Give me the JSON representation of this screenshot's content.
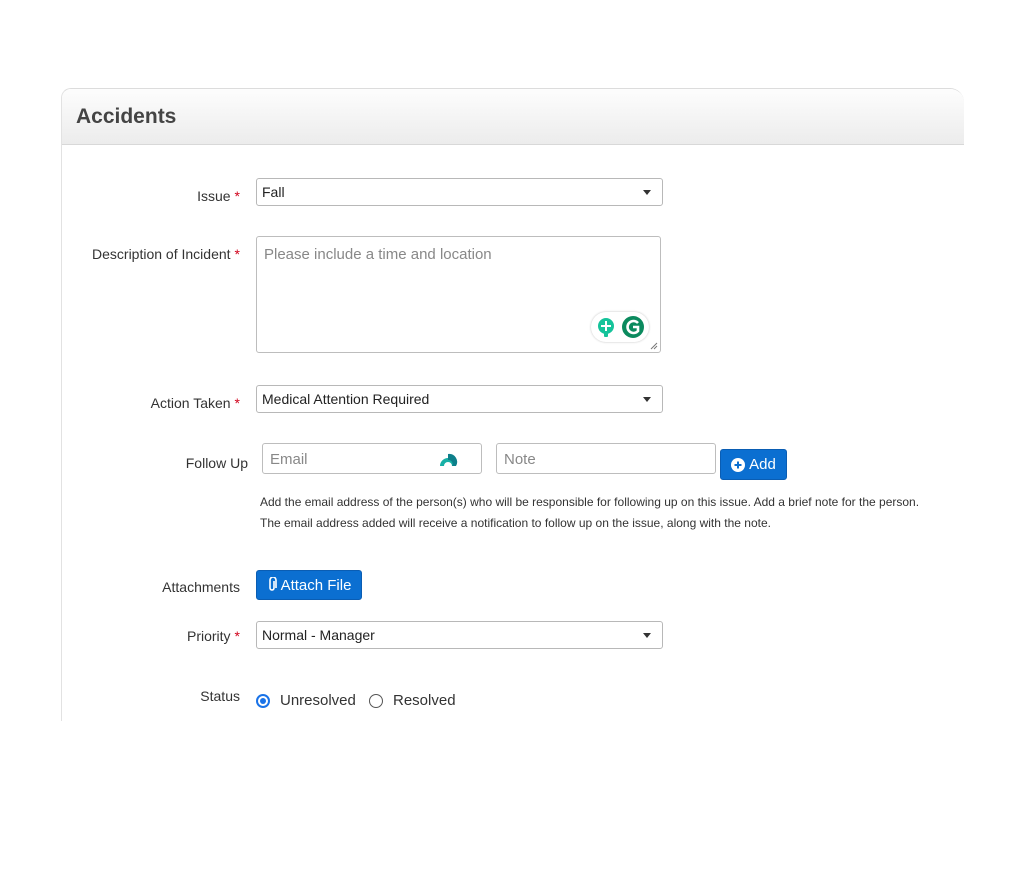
{
  "panel": {
    "title": "Accidents"
  },
  "issue": {
    "label": "Issue",
    "required": "*",
    "value": "Fall"
  },
  "description": {
    "label": "Description of Incident",
    "required": "*",
    "placeholder": "Please include a time and location"
  },
  "action": {
    "label": "Action Taken",
    "required": "*",
    "value": "Medical Attention Required"
  },
  "follow_up": {
    "label": "Follow Up",
    "email_placeholder": "Email",
    "note_placeholder": "Note",
    "add_label": "Add",
    "help_line1": "Add the email address of the person(s) who will be responsible for following up on this issue. Add a brief note for the person.",
    "help_line2": "The email address added will receive a notification to follow up on the issue, along with the note."
  },
  "attachments": {
    "label": "Attachments",
    "button_label": "Attach File"
  },
  "priority": {
    "label": "Priority",
    "required": "*",
    "value": "Normal - Manager"
  },
  "status": {
    "label": "Status",
    "options": [
      {
        "label": "Unresolved",
        "selected": true
      },
      {
        "label": "Resolved",
        "selected": false
      }
    ]
  },
  "colors": {
    "accent": "#0b6fd1",
    "required": "#d0021b",
    "radio": "#1a73e8",
    "grammarly": "#15c39a"
  }
}
